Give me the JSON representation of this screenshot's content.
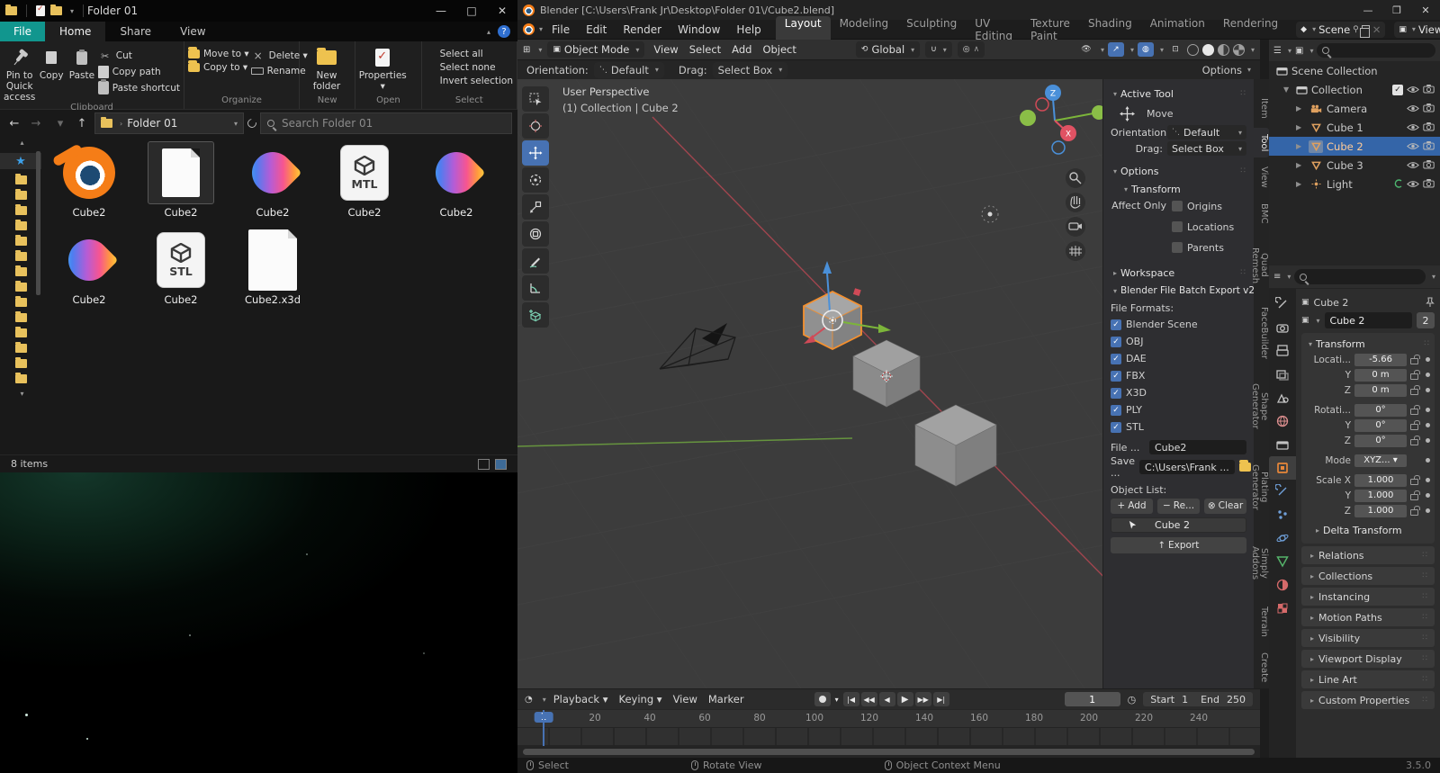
{
  "theme": {
    "accent_blue": "#4772b3",
    "blender_orange": "#f57d17",
    "explorer_teal": "#11968e",
    "selection_blue": "#3465a8",
    "active_outline_orange": "#f5902e"
  },
  "explorer": {
    "title": "Folder 01",
    "tabs": {
      "file": "File",
      "items": [
        "Home",
        "Share",
        "View"
      ],
      "active": "Home"
    },
    "ribbon": {
      "groups": [
        {
          "label": "Clipboard",
          "big": [
            "Pin to Quick access",
            "Copy",
            "Paste"
          ],
          "small": [
            "Cut",
            "Copy path",
            "Paste shortcut"
          ]
        },
        {
          "label": "Organize",
          "small_cols": [
            [
              "Move to",
              "Copy to"
            ],
            [
              "Delete",
              "Rename"
            ]
          ]
        },
        {
          "label": "New",
          "big": [
            "New folder"
          ]
        },
        {
          "label": "Open",
          "big": [
            "Properties"
          ]
        },
        {
          "label": "Select",
          "small": [
            "Select all",
            "Select none",
            "Invert selection"
          ]
        }
      ]
    },
    "address": {
      "path": "Folder 01",
      "search_placeholder": "Search Folder 01"
    },
    "files": [
      {
        "name": "Cube2",
        "icon": "blender"
      },
      {
        "name": "Cube2",
        "icon": "doc-blank",
        "selected": true
      },
      {
        "name": "Cube2",
        "icon": "drop"
      },
      {
        "name": "Cube2",
        "icon": "doc-3d",
        "badge": "MTL"
      },
      {
        "name": "Cube2",
        "icon": "drop"
      },
      {
        "name": "Cube2",
        "icon": "drop"
      },
      {
        "name": "Cube2",
        "icon": "doc-3d",
        "badge": "STL"
      },
      {
        "name": "Cube2.x3d",
        "icon": "doc-plain"
      }
    ],
    "status_left": "8 items"
  },
  "blender": {
    "title": "Blender [C:\\Users\\Frank Jr\\Desktop\\Folder 01\\/Cube2.blend]",
    "menus": [
      "File",
      "Edit",
      "Render",
      "Window",
      "Help"
    ],
    "workspaces": [
      "Layout",
      "Modeling",
      "Sculpting",
      "UV Editing",
      "Texture Paint",
      "Shading",
      "Animation",
      "Rendering"
    ],
    "active_workspace": "Layout",
    "scene_name": "Scene",
    "viewlayer_name": "ViewLayer",
    "header": {
      "mode": "Object Mode",
      "menus": [
        "View",
        "Select",
        "Add",
        "Object"
      ],
      "orientation": "Global",
      "options_label": "Options"
    },
    "tool_settings": {
      "orientation_label": "Orientation:",
      "orientation_value": "Default",
      "drag_label": "Drag:",
      "drag_value": "Select Box"
    },
    "viewport": {
      "overlay_title": "User Perspective",
      "overlay_subtitle": "(1) Collection | Cube 2",
      "axis_z": "Z",
      "axis_x": "X"
    },
    "npanel": {
      "active_tool_label": "Active Tool",
      "tool_name": "Move",
      "orientation_label": "Orientation",
      "orientation_value": "Default",
      "drag_label": "Drag:",
      "drag_value": "Select Box",
      "options_label": "Options",
      "transform_label": "Transform",
      "affect_only_label": "Affect Only",
      "affect_options": [
        "Origins",
        "Locations",
        "Parents"
      ],
      "workspace_label": "Workspace",
      "export_section_label": "Blender File Batch Export v2",
      "file_formats_label": "File Formats:",
      "formats": [
        "Blender Scene",
        "OBJ",
        "DAE",
        "FBX",
        "X3D",
        "PLY",
        "STL"
      ],
      "file_label": "File ...",
      "file_value": "Cube2",
      "save_label": "Save ...",
      "save_value": "C:\\Users\\Frank ...",
      "object_list_label": "Object List:",
      "add_label": "Add",
      "remove_label": "Re...",
      "clear_label": "Clear",
      "object_item": "Cube 2",
      "export_button": "Export"
    },
    "sidebar_tabs": [
      "Item",
      "Tool",
      "View",
      "BMC",
      "Quad Remesh",
      "FaceBuilder",
      "Shape Generator",
      "Plating Generator",
      "Simply Addons",
      "Terrain",
      "Create"
    ],
    "active_sidebar_tab": "Tool",
    "outliner": {
      "scene_collection": "Scene Collection",
      "collection": "Collection",
      "items": [
        {
          "label": "Camera",
          "type": "camera"
        },
        {
          "label": "Cube 1",
          "type": "mesh"
        },
        {
          "label": "Cube 2",
          "type": "mesh",
          "selected": true
        },
        {
          "label": "Cube 3",
          "type": "mesh"
        },
        {
          "label": "Light",
          "type": "light"
        }
      ]
    },
    "properties": {
      "breadcrumb": "Cube 2",
      "name_value": "Cube 2",
      "users_badge": "2",
      "transform_label": "Transform",
      "rows": [
        {
          "label": "Locati...",
          "value": "-5.66",
          "lock": true
        },
        {
          "label": "Y",
          "value": "0 m",
          "lock": true
        },
        {
          "label": "Z",
          "value": "0 m",
          "lock": true
        },
        {
          "label": "Rotati...",
          "value": "0°",
          "lock": true,
          "gap": true
        },
        {
          "label": "Y",
          "value": "0°",
          "lock": true
        },
        {
          "label": "Z",
          "value": "0°",
          "lock": true
        },
        {
          "label": "Mode",
          "value": "XYZ...",
          "lock": false,
          "dropdown": true,
          "gap": true
        },
        {
          "label": "Scale X",
          "value": "1.000",
          "lock": true,
          "gap": true
        },
        {
          "label": "Y",
          "value": "1.000",
          "lock": true
        },
        {
          "label": "Z",
          "value": "1.000",
          "lock": true
        }
      ],
      "delta_label": "Delta Transform",
      "panels": [
        "Relations",
        "Collections",
        "Instancing",
        "Motion Paths",
        "Visibility",
        "Viewport Display",
        "Line Art",
        "Custom Properties"
      ]
    },
    "timeline": {
      "menus": [
        "Playback",
        "Keying",
        "View",
        "Marker"
      ],
      "current_frame": "1",
      "start_label": "Start",
      "start_value": "1",
      "end_label": "End",
      "end_value": "250",
      "ticks": [
        "1",
        "20",
        "40",
        "60",
        "80",
        "100",
        "120",
        "140",
        "160",
        "180",
        "200",
        "220",
        "240"
      ]
    },
    "statusbar": {
      "items": [
        "Select",
        "Rotate View",
        "Object Context Menu"
      ],
      "version": "3.5.0"
    }
  }
}
